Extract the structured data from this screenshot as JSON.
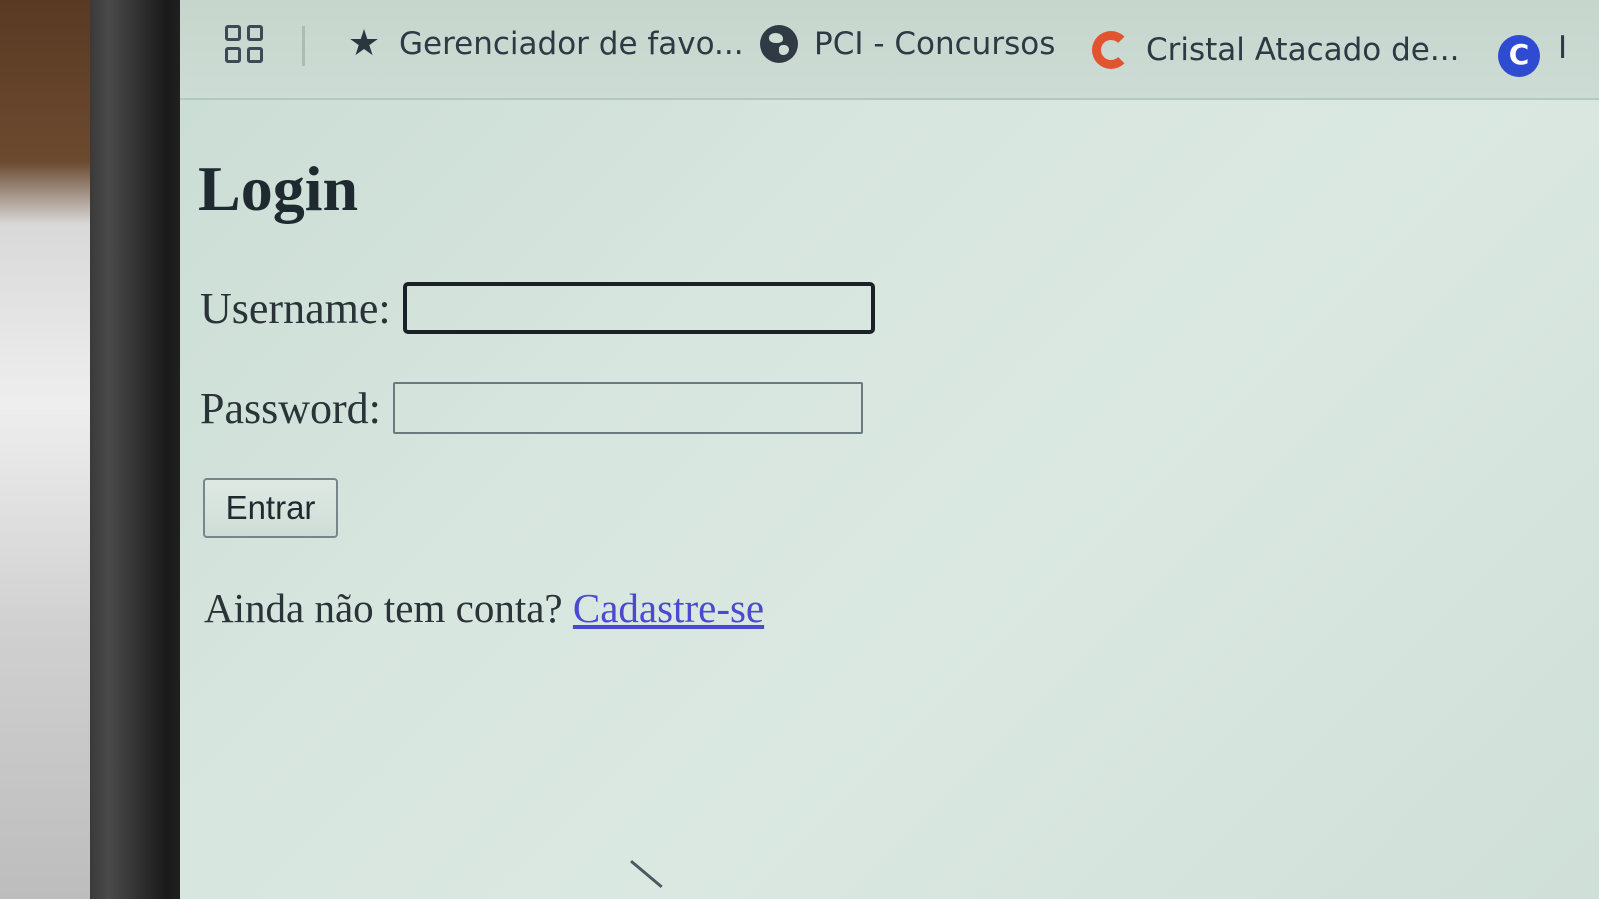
{
  "bookmarks_bar": {
    "items": [
      {
        "label": "Gerenciador de favo...",
        "icon": "star-icon"
      },
      {
        "label": "PCI - Concursos",
        "icon": "globe-icon"
      },
      {
        "label": "Cristal Atacado de...",
        "icon": "c-red-icon"
      },
      {
        "label": "",
        "icon": "c-blue-icon"
      }
    ],
    "trailing_text": "I"
  },
  "page": {
    "title": "Login",
    "username_label": "Username:",
    "username_value": "",
    "password_label": "Password:",
    "password_value": "",
    "submit_label": "Entrar",
    "signup_prompt": "Ainda não tem conta?",
    "signup_link": "Cadastre-se"
  },
  "colors": {
    "link": "#4a4ad0",
    "screen_background": "#d7e6df",
    "cristal_icon": "#e2532f",
    "blue_icon": "#2f4bd1"
  }
}
